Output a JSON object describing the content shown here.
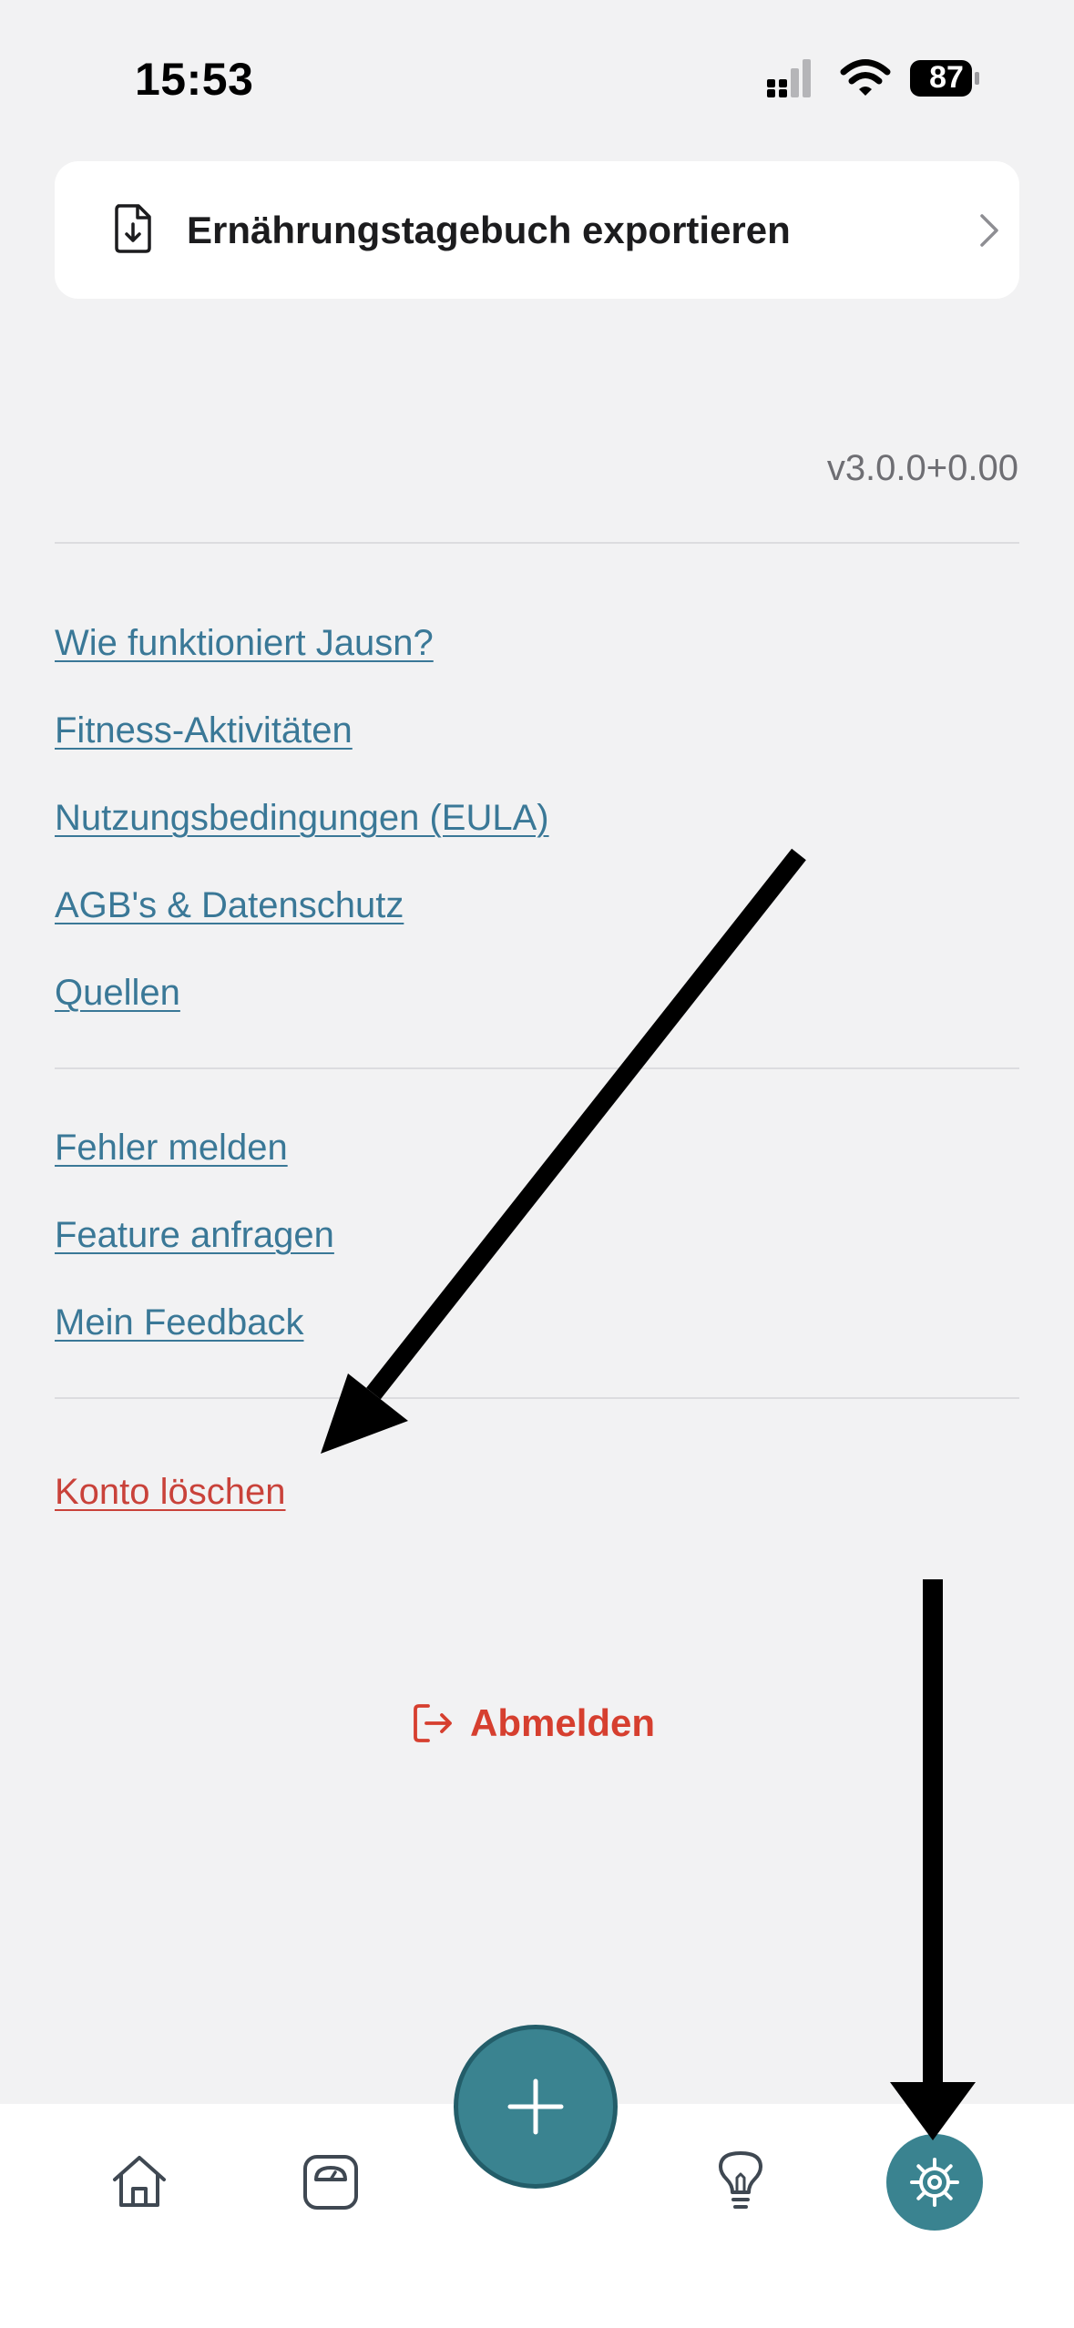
{
  "status_bar": {
    "time": "15:53",
    "battery_level": "87",
    "icons": [
      "signal-icon",
      "wifi-icon",
      "battery-icon"
    ]
  },
  "export": {
    "label": "Ernährungstagebuch exportieren",
    "icon": "document-download-icon"
  },
  "version": "v3.0.0+0.00",
  "info_links": [
    "Wie funktioniert Jausn?",
    "Fitness-Aktivitäten",
    "Nutzungsbedingungen (EULA)",
    "AGB's & Datenschutz",
    "Quellen"
  ],
  "feedback_links": [
    "Fehler melden",
    "Feature anfragen",
    "Mein Feedback"
  ],
  "delete_account": "Konto löschen",
  "logout": {
    "label": "Abmelden",
    "icon": "logout-icon"
  },
  "tab_bar": {
    "items": [
      "home-icon",
      "scale-icon",
      "add-icon",
      "lightbulb-icon",
      "gear-icon"
    ],
    "active": "gear-icon"
  },
  "colors": {
    "accent": "#3a8390",
    "link": "#3a7897",
    "danger": "#c9423a",
    "logout": "#d63f2f",
    "background": "#f2f2f3"
  }
}
